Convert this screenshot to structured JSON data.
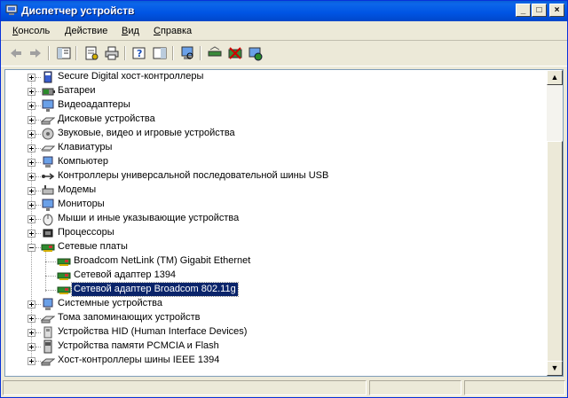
{
  "window": {
    "title": "Диспетчер устройств"
  },
  "menubar": {
    "items": [
      {
        "letter": "К",
        "rest": "онсоль"
      },
      {
        "letter": "Д",
        "rest": "ействие"
      },
      {
        "letter": "В",
        "rest": "ид"
      },
      {
        "letter": "С",
        "rest": "правка"
      }
    ]
  },
  "toolbar": {
    "icons": [
      "back-arrow-icon",
      "forward-arrow-icon",
      "console-tree-icon",
      "properties-icon",
      "print-icon",
      "help-icon",
      "show-hide-icon",
      "scan-hardware-icon",
      "update-driver-icon",
      "uninstall-icon",
      "disable-icon"
    ]
  },
  "tree": {
    "items": [
      {
        "label": "Secure Digital хост-контроллеры",
        "icon": "sd-host-icon",
        "expanded": false,
        "level": 0
      },
      {
        "label": "Батареи",
        "icon": "battery-icon",
        "expanded": false,
        "level": 0
      },
      {
        "label": "Видеоадаптеры",
        "icon": "display-adapter-icon",
        "expanded": false,
        "level": 0
      },
      {
        "label": "Дисковые устройства",
        "icon": "disk-drive-icon",
        "expanded": false,
        "level": 0
      },
      {
        "label": "Звуковые, видео и игровые устройства",
        "icon": "sound-device-icon",
        "expanded": false,
        "level": 0
      },
      {
        "label": "Клавиатуры",
        "icon": "keyboard-icon",
        "expanded": false,
        "level": 0
      },
      {
        "label": "Компьютер",
        "icon": "computer-icon",
        "expanded": false,
        "level": 0
      },
      {
        "label": "Контроллеры универсальной последовательной шины USB",
        "icon": "usb-icon",
        "expanded": false,
        "level": 0
      },
      {
        "label": "Модемы",
        "icon": "modem-icon",
        "expanded": false,
        "level": 0
      },
      {
        "label": "Мониторы",
        "icon": "monitor-icon",
        "expanded": false,
        "level": 0
      },
      {
        "label": "Мыши и иные указывающие устройства",
        "icon": "mouse-icon",
        "expanded": false,
        "level": 0
      },
      {
        "label": "Процессоры",
        "icon": "processor-icon",
        "expanded": false,
        "level": 0
      },
      {
        "label": "Сетевые платы",
        "icon": "network-card-icon",
        "expanded": true,
        "level": 0
      },
      {
        "label": "Broadcom NetLink (TM) Gigabit Ethernet",
        "icon": "network-card-icon",
        "level": 1
      },
      {
        "label": "Сетевой адаптер 1394",
        "icon": "network-card-icon",
        "level": 1
      },
      {
        "label": "Сетевой адаптер Broadcom 802.11g",
        "icon": "network-card-icon",
        "level": 1,
        "selected": true
      },
      {
        "label": "Системные устройства",
        "icon": "system-device-icon",
        "expanded": false,
        "level": 0
      },
      {
        "label": "Тома запоминающих устройств",
        "icon": "storage-volume-icon",
        "expanded": false,
        "level": 0
      },
      {
        "label": "Устройства HID (Human Interface Devices)",
        "icon": "hid-icon",
        "expanded": false,
        "level": 0
      },
      {
        "label": "Устройства памяти PCMCIA и Flash",
        "icon": "pcmcia-icon",
        "expanded": false,
        "level": 0
      },
      {
        "label": "Хост-контроллеры шины IEEE 1394",
        "icon": "ieee1394-icon",
        "expanded": false,
        "level": 0
      }
    ]
  },
  "colors": {
    "titlebar": "#0054e3",
    "selection": "#0a246a",
    "window_bg": "#ece9d8"
  }
}
